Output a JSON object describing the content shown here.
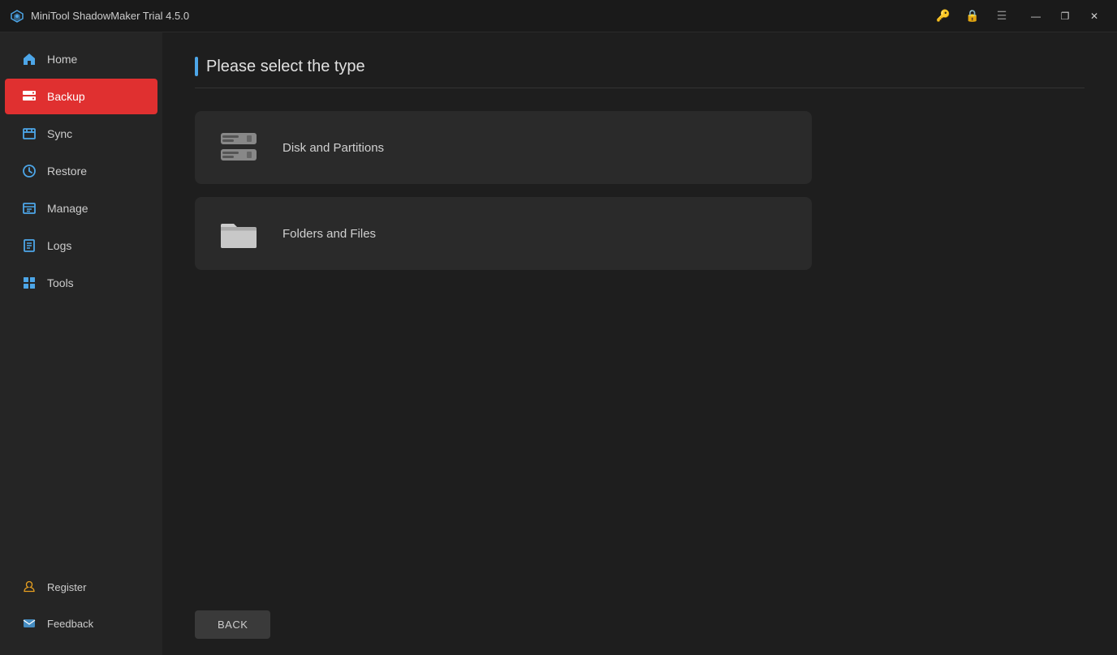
{
  "titleBar": {
    "appTitle": "MiniTool ShadowMaker Trial 4.5.0",
    "windowControls": {
      "minimize": "—",
      "restore": "❐",
      "close": "✕"
    }
  },
  "sidebar": {
    "items": [
      {
        "id": "home",
        "label": "Home",
        "active": false
      },
      {
        "id": "backup",
        "label": "Backup",
        "active": true
      },
      {
        "id": "sync",
        "label": "Sync",
        "active": false
      },
      {
        "id": "restore",
        "label": "Restore",
        "active": false
      },
      {
        "id": "manage",
        "label": "Manage",
        "active": false
      },
      {
        "id": "logs",
        "label": "Logs",
        "active": false
      },
      {
        "id": "tools",
        "label": "Tools",
        "active": false
      }
    ],
    "bottomItems": [
      {
        "id": "register",
        "label": "Register"
      },
      {
        "id": "feedback",
        "label": "Feedback"
      }
    ]
  },
  "mainContent": {
    "sectionTitle": "Please select the type",
    "options": [
      {
        "id": "disk-partitions",
        "label": "Disk and Partitions"
      },
      {
        "id": "folders-files",
        "label": "Folders and Files"
      }
    ],
    "backButton": "BACK"
  }
}
